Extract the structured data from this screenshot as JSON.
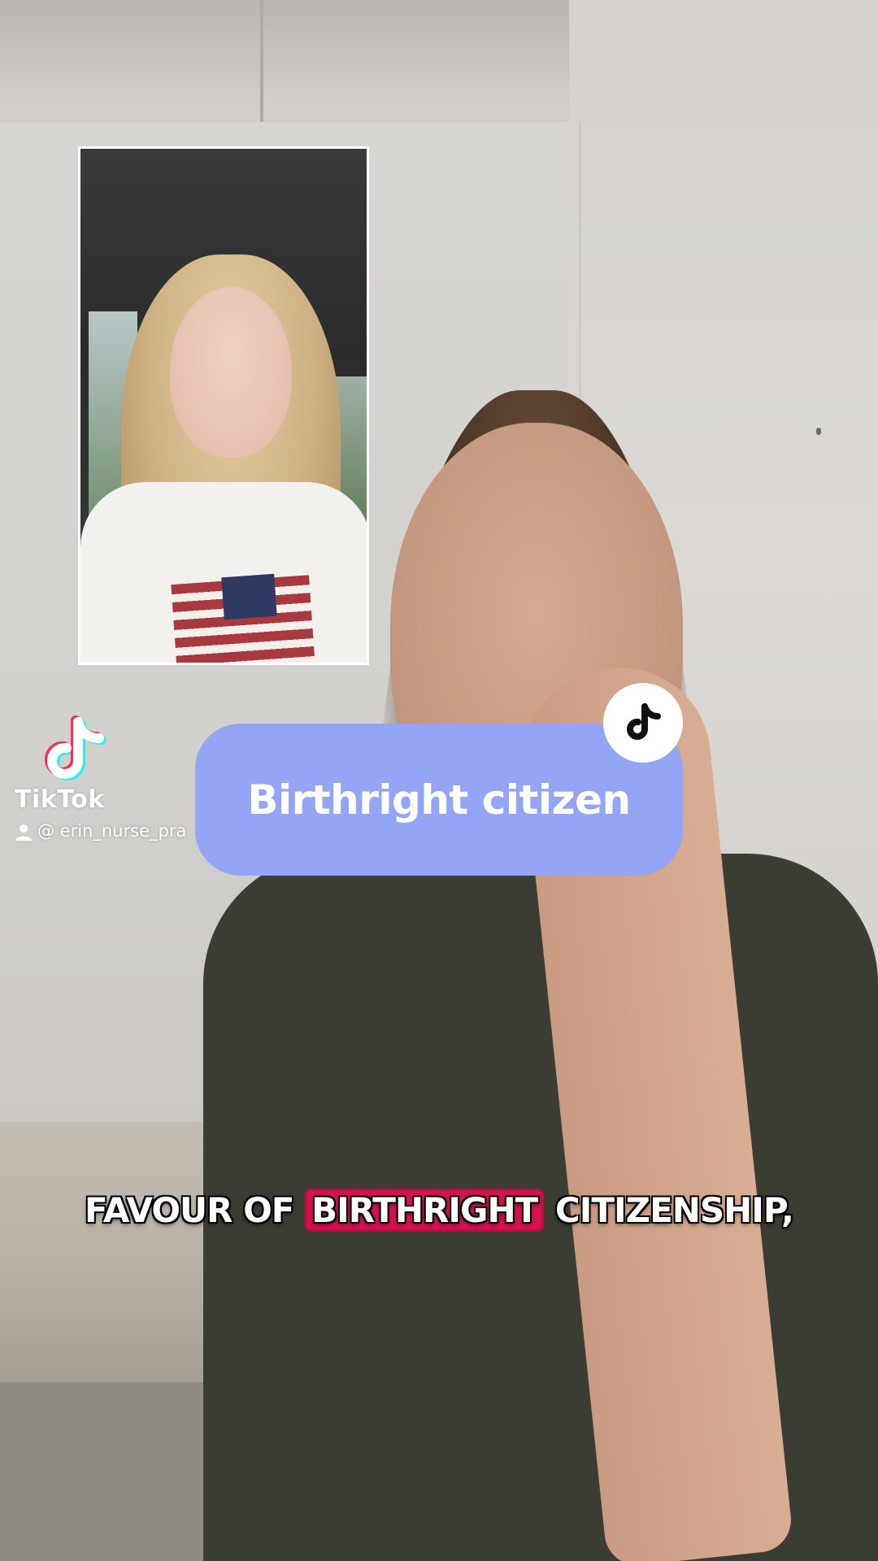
{
  "pip_video": {
    "description_icon": "picture-in-picture"
  },
  "watermark": {
    "logo_icon": "tiktok-note-icon",
    "wordmark": "TikTok",
    "handle": "@ erin_nurse_pra"
  },
  "search_bubble": {
    "text": "Birthright citizen",
    "badge_icon": "tiktok-note-icon",
    "color": "#95a5f6"
  },
  "caption": {
    "before": "FAVOUR OF ",
    "highlight": "BIRTHRIGHT",
    "after": " CITIZENSHIP,",
    "highlight_color": "#d4134f"
  }
}
